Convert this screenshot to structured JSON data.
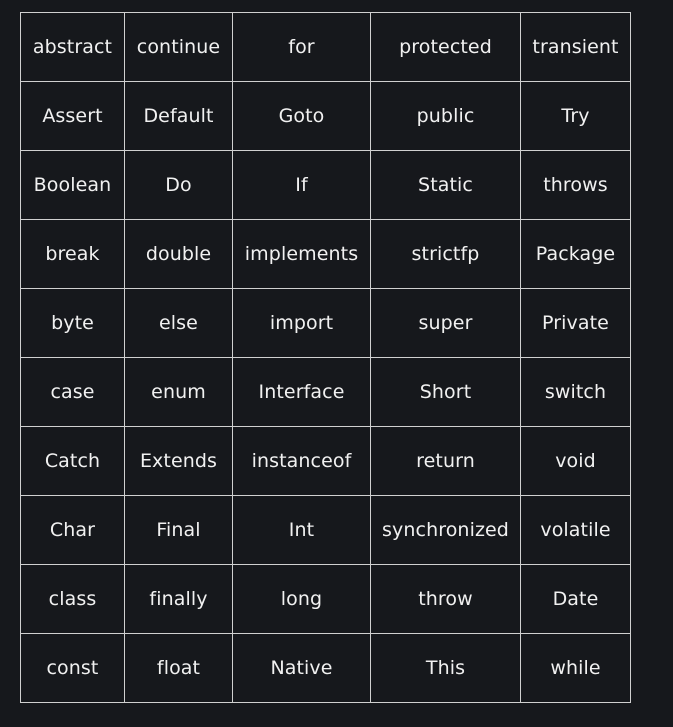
{
  "keywords_table": {
    "rows": [
      [
        "abstract",
        "continue",
        "for",
        "protected",
        "transient"
      ],
      [
        "Assert",
        "Default",
        "Goto",
        "public",
        "Try"
      ],
      [
        "Boolean",
        "Do",
        "If",
        "Static",
        "throws"
      ],
      [
        "break",
        "double",
        "implements",
        "strictfp",
        "Package"
      ],
      [
        "byte",
        "else",
        "import",
        "super",
        "Private"
      ],
      [
        "case",
        "enum",
        "Interface",
        "Short",
        "switch"
      ],
      [
        "Catch",
        "Extends",
        "instanceof",
        "return",
        "void"
      ],
      [
        "Char",
        "Final",
        "Int",
        "synchronized",
        "volatile"
      ],
      [
        "class",
        "finally",
        "long",
        "throw",
        "Date"
      ],
      [
        "const",
        "float",
        "Native",
        "This",
        "while"
      ]
    ]
  }
}
